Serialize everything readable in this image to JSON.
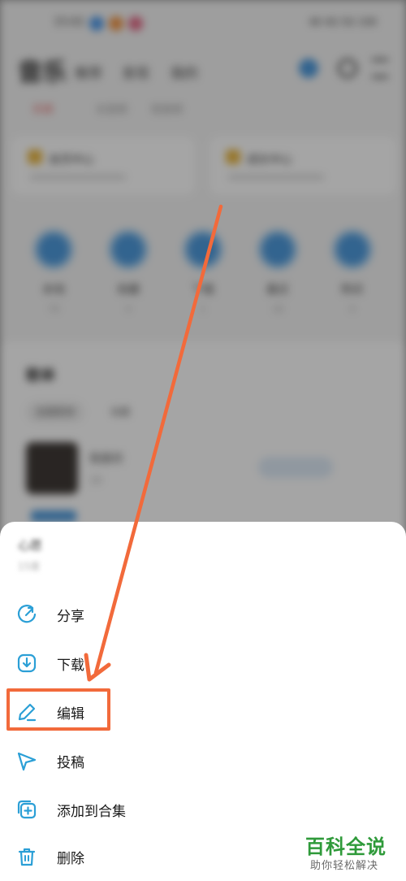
{
  "background_app": {
    "status_time": "15:02",
    "status_right": "46 4G 5G 100",
    "title": "音乐",
    "top_tabs": [
      "推荐",
      "发现",
      "我的"
    ],
    "sub_tabs": [
      "乐库",
      "长音频",
      "短音频"
    ],
    "cards": [
      "会员中心",
      "成长中心"
    ],
    "categories": [
      {
        "label": "本地",
        "count": "79"
      },
      {
        "label": "收藏",
        "count": "4"
      },
      {
        "label": "下载",
        "count": "1"
      },
      {
        "label": "最近",
        "count": "18"
      },
      {
        "label": "购买",
        "count": "0"
      }
    ],
    "list_title": "歌单",
    "chips": [
      "自建歌单",
      "收藏"
    ],
    "album_title": "我喜欢",
    "album_count": "18"
  },
  "sheet": {
    "title": "心愿",
    "subtitle": "15首",
    "items": [
      {
        "label": "分享",
        "icon": "share-icon"
      },
      {
        "label": "下载",
        "icon": "download-icon"
      },
      {
        "label": "编辑",
        "icon": "edit-icon"
      },
      {
        "label": "投稿",
        "icon": "send-icon"
      },
      {
        "label": "添加到合集",
        "icon": "add-to-collection-icon"
      },
      {
        "label": "删除",
        "icon": "trash-icon"
      }
    ]
  },
  "annotation": {
    "highlighted_item": "编辑",
    "arrow_color": "#f26a3b"
  },
  "watermark": {
    "main": "百科全说",
    "sub": "助你轻松解决"
  },
  "colors": {
    "icon_blue": "#2b9fd6",
    "highlight": "#f26a3b",
    "watermark_green": "#2f9a3a"
  }
}
